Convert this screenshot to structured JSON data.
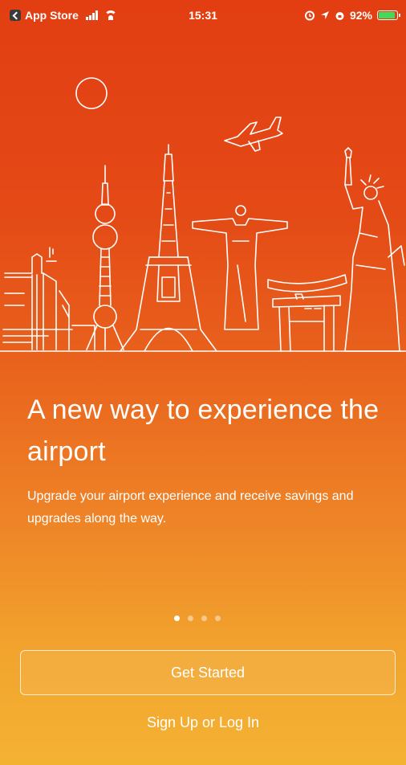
{
  "status_bar": {
    "back_app": "App Store",
    "time": "15:31",
    "battery": "92%",
    "battery_level": 0.92
  },
  "onboarding": {
    "headline": "A new way to experience the airport",
    "subtext": "Upgrade your airport experience and receive savings and upgrades along the way.",
    "page_count": 4,
    "current_page": 1
  },
  "actions": {
    "get_started_label": "Get Started",
    "signup_label": "Sign Up or Log In"
  },
  "colors": {
    "gradient_top": "#e23e12",
    "gradient_bottom": "#f4b233",
    "line_art": "#ffffff",
    "battery_green": "#3ddc5a"
  },
  "icons": [
    "app-store-back-icon",
    "signal-icon",
    "wifi-icon",
    "location-icon",
    "alarm-icon",
    "battery-icon"
  ]
}
